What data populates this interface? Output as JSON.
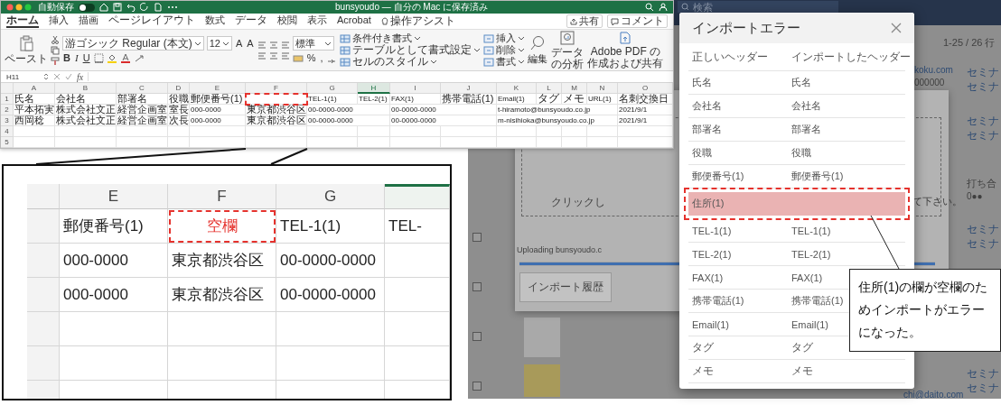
{
  "excel_window": {
    "autosave_label": "自動保存",
    "autosave_on": false,
    "title": "bunsyoudo — 自分の Mac に保存済み",
    "tabs": [
      {
        "label": "ホーム",
        "selected": true
      },
      {
        "label": "挿入",
        "selected": false
      },
      {
        "label": "描画",
        "selected": false
      },
      {
        "label": "ページレイアウト",
        "selected": false
      },
      {
        "label": "数式",
        "selected": false
      },
      {
        "label": "データ",
        "selected": false
      },
      {
        "label": "校閲",
        "selected": false
      },
      {
        "label": "表示",
        "selected": false
      },
      {
        "label": "Acrobat",
        "selected": false
      }
    ],
    "tell_me": "操作アシスト",
    "share": "共有",
    "comment": "コメント",
    "ribbon": {
      "paste": "ペースト",
      "font_name": "游ゴシック Regular (本文)",
      "font_size": "12",
      "grow_font": "A",
      "shrink_font": "A",
      "bold": "B",
      "italic": "I",
      "underline": "U",
      "number_format": "標準",
      "percent": "%",
      "comma": ",",
      "styles": [
        "条件付き書式",
        "テーブルとして書式設定",
        "セルのスタイル"
      ],
      "cells": [
        "挿入",
        "削除",
        "書式"
      ],
      "find": "編集",
      "analyze": "データの分析",
      "acrobat": "Adobe PDF の作成および共有"
    },
    "name_box": "H11",
    "formula_label": "fx",
    "columns": [
      {
        "label": "A",
        "selected": false
      },
      {
        "label": "B",
        "selected": false
      },
      {
        "label": "C",
        "selected": false
      },
      {
        "label": "D",
        "selected": false
      },
      {
        "label": "E",
        "selected": false
      },
      {
        "label": "F",
        "selected": false
      },
      {
        "label": "G",
        "selected": false
      },
      {
        "label": "H",
        "selected": true
      },
      {
        "label": "I",
        "selected": false
      },
      {
        "label": "J",
        "selected": false
      },
      {
        "label": "K",
        "selected": false
      },
      {
        "label": "L",
        "selected": false
      },
      {
        "label": "M",
        "selected": false
      },
      {
        "label": "N",
        "selected": false
      },
      {
        "label": "O",
        "selected": false
      }
    ],
    "rows": [
      {
        "number": "1",
        "cells": [
          {
            "text": "氏名",
            "highlighted": false
          },
          {
            "text": "会社名",
            "highlighted": false
          },
          {
            "text": "部署名",
            "highlighted": false
          },
          {
            "text": "役職",
            "highlighted": false
          },
          {
            "text": "郵便番号(1)",
            "highlighted": false
          },
          {
            "highlighted": true
          },
          {
            "text": "TEL-1(1)",
            "highlighted": false
          },
          {
            "text": "TEL-2(1)",
            "highlighted": false
          },
          {
            "text": "FAX(1)",
            "highlighted": false
          },
          {
            "text": "携帯電話(1)",
            "highlighted": false
          },
          {
            "text": "Email(1)",
            "highlighted": false
          },
          {
            "text": "タグ",
            "highlighted": false
          },
          {
            "text": "メモ",
            "highlighted": false
          },
          {
            "text": "URL(1)",
            "highlighted": false
          },
          {
            "text": "名刺交換日",
            "highlighted": false
          }
        ]
      },
      {
        "number": "2",
        "cells": [
          {
            "text": "平本拓実",
            "highlighted": false
          },
          {
            "text": "株式会社文正",
            "highlighted": false
          },
          {
            "text": "経営企画室",
            "highlighted": false
          },
          {
            "text": "室長",
            "highlighted": false
          },
          {
            "text": "000-0000",
            "highlighted": false
          },
          {
            "text": "東京都渋谷区",
            "highlighted": false
          },
          {
            "text": "00-0000-0000",
            "highlighted": false
          },
          {
            "highlighted": false
          },
          {
            "text": "00-0000-0000",
            "highlighted": false
          },
          {
            "highlighted": false
          },
          {
            "text": "t-hiramoto@bunsyoudo.co.jp",
            "highlighted": false
          },
          {
            "highlighted": false
          },
          {
            "highlighted": false
          },
          {
            "highlighted": false
          },
          {
            "text": "2021/9/1",
            "highlighted": false
          }
        ]
      },
      {
        "number": "3",
        "cells": [
          {
            "text": "西岡稔",
            "highlighted": false
          },
          {
            "text": "株式会社文正",
            "highlighted": false
          },
          {
            "text": "経営企画室",
            "highlighted": false
          },
          {
            "text": "次長",
            "highlighted": false
          },
          {
            "text": "000-0000",
            "highlighted": false
          },
          {
            "text": "東京都渋谷区",
            "highlighted": false
          },
          {
            "text": "00-0000-0000",
            "highlighted": false
          },
          {
            "highlighted": false
          },
          {
            "text": "00-0000-0000",
            "highlighted": false
          },
          {
            "highlighted": false
          },
          {
            "text": "m-nisihioka@bunsyoudo.co.jp",
            "highlighted": false
          },
          {
            "highlighted": false
          },
          {
            "highlighted": false
          },
          {
            "highlighted": false
          },
          {
            "text": "2021/9/1",
            "highlighted": false
          }
        ]
      },
      {
        "number": "4"
      },
      {
        "number": "5"
      }
    ]
  },
  "zoom_inset": {
    "columns": [
      {
        "label": "E",
        "selected": false
      },
      {
        "label": "F",
        "selected": false
      },
      {
        "label": "G",
        "selected": false
      },
      {
        "selected": true
      }
    ],
    "rows": [
      {
        "cells": [
          {
            "text": "郵便番号(1)",
            "highlighted": false
          },
          {
            "text": "空欄",
            "highlighted": true
          },
          {
            "text": "TEL-1(1)",
            "highlighted": false
          },
          {
            "text": "TEL-",
            "highlighted": false
          }
        ]
      },
      {
        "cells": [
          {
            "text": "000-0000",
            "highlighted": false
          },
          {
            "text": "東京都渋谷区",
            "highlighted": false
          },
          {
            "text": "00-0000-0000",
            "highlighted": false
          }
        ]
      },
      {
        "cells": [
          {
            "text": "000-0000",
            "highlighted": false
          },
          {
            "text": "東京都渋谷区",
            "highlighted": false
          },
          {
            "text": "00-0000-0000",
            "highlighted": false
          }
        ]
      }
    ]
  },
  "background_app": {
    "search_placeholder": "検索",
    "row_count": "1-25 / 26 行",
    "email_partial": "koku.com",
    "phone_partial": "000000",
    "email_partial_2": "chi@daito.com",
    "tags": [
      "セミナ",
      "セミナ",
      "セミナ",
      "セミナ",
      "セミナ",
      "セミナ",
      "セミナ",
      "セミナ"
    ],
    "memo": [
      "打ち合",
      "0●●"
    ],
    "row_checkboxes": [
      {
        "checked": false
      },
      {
        "checked": false
      },
      {
        "checked": false
      },
      {
        "checked": false
      }
    ],
    "upload_modal": {
      "drop_hint_left": "クリックし",
      "drop_hint_right": "て下さい。",
      "upload_status": "Uploading bunsyoudo.c",
      "level": 1,
      "history_button": "インポート履歴"
    }
  },
  "import_error_dialog": {
    "title": "インポートエラー",
    "header_correct": "正しいヘッダー",
    "header_imported": "インポートしたヘッダー",
    "rows": [
      {
        "correct": "氏名",
        "imported": "氏名",
        "error": false
      },
      {
        "correct": "会社名",
        "imported": "会社名",
        "error": false
      },
      {
        "correct": "部署名",
        "imported": "部署名",
        "error": false
      },
      {
        "correct": "役職",
        "imported": "役職",
        "error": false
      },
      {
        "correct": "郵便番号(1)",
        "imported": "郵便番号(1)",
        "error": false
      },
      {
        "correct": "住所(1)",
        "error": true
      },
      {
        "correct": "TEL-1(1)",
        "imported": "TEL-1(1)",
        "error": false
      },
      {
        "correct": "TEL-2(1)",
        "imported": "TEL-2(1)",
        "error": false
      },
      {
        "correct": "FAX(1)",
        "imported": "FAX(1)",
        "error": false
      },
      {
        "correct": "携帯電話(1)",
        "imported": "携帯電話(1)",
        "error": false
      },
      {
        "correct": "Email(1)",
        "imported": "Email(1)",
        "error": false
      },
      {
        "correct": "タグ",
        "imported": "タグ",
        "error": false
      },
      {
        "correct": "メモ",
        "imported": "メモ",
        "error": false
      }
    ]
  },
  "callout": {
    "text": "住所(1)の欄が空欄のためインポートがエラーになった。"
  }
}
